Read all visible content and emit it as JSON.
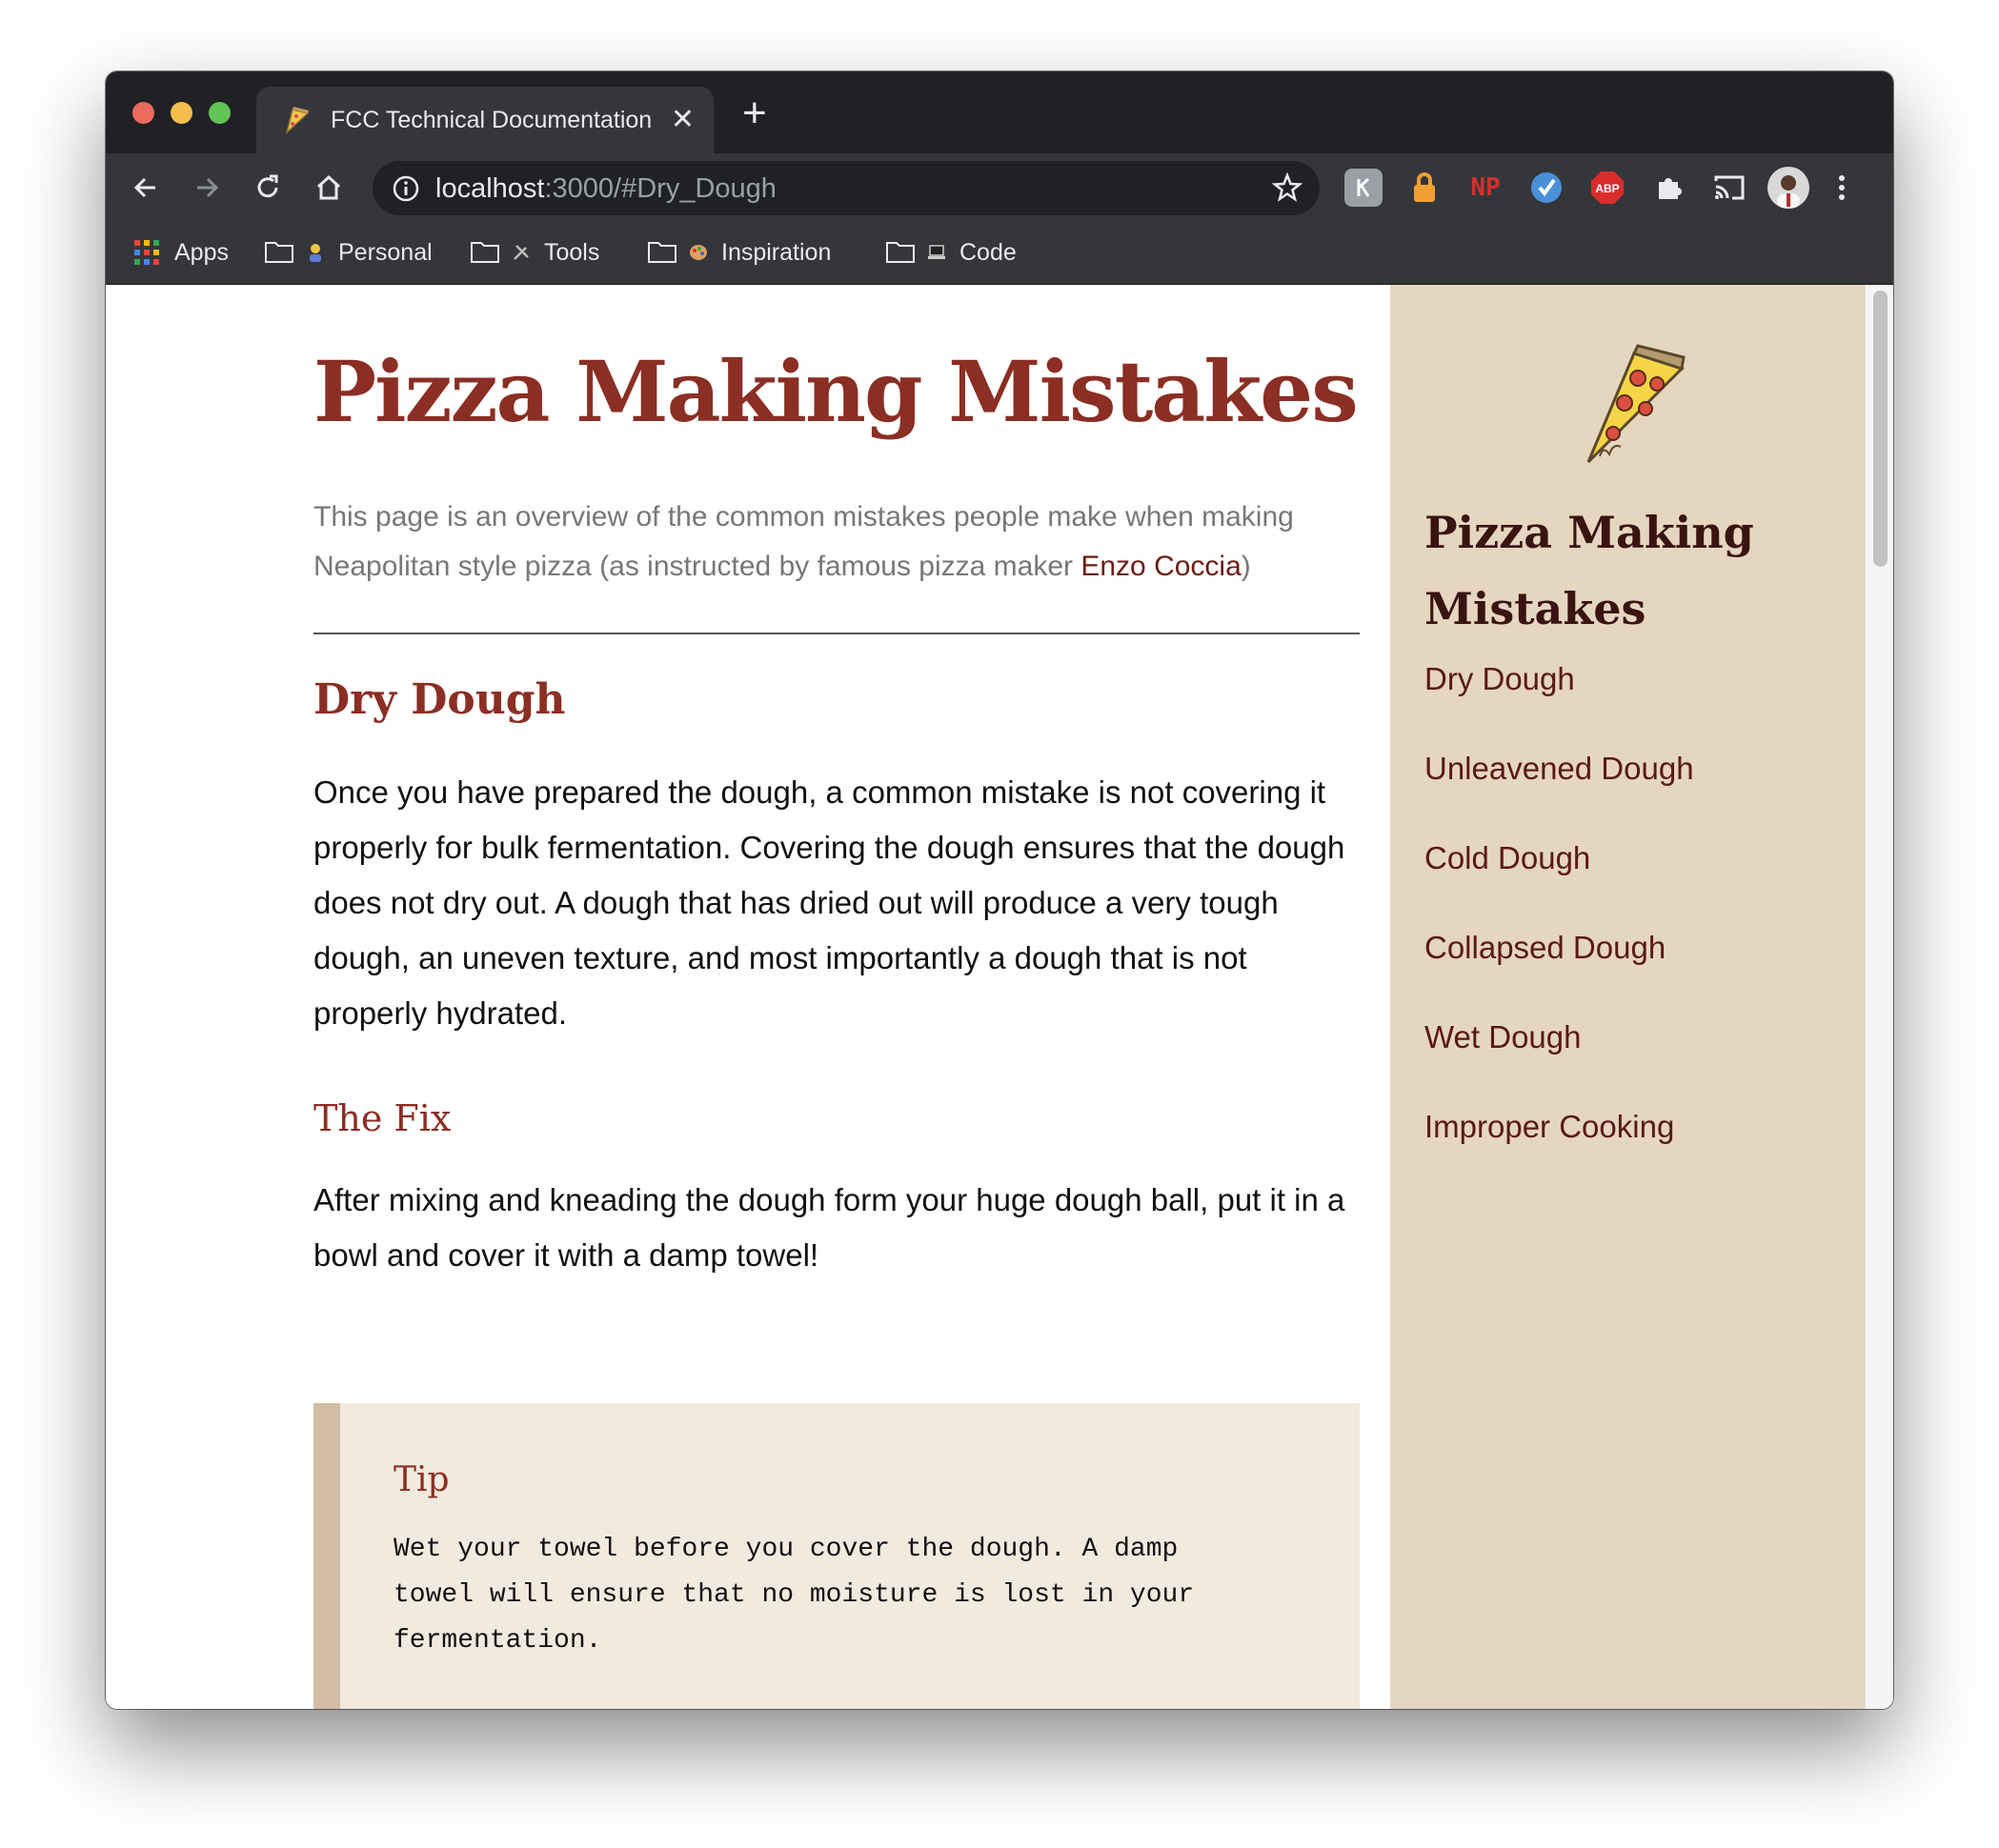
{
  "browser": {
    "tab_title": "FCC Technical Documentation",
    "tab_close": "✕",
    "new_tab": "+",
    "url_host": "localhost",
    "url_rest": ":3000/#Dry_Dough",
    "extensions": [
      "keep-icon",
      "lock-icon",
      "np-icon",
      "tracker-icon",
      "adblock-icon",
      "puzzle-icon",
      "cast-icon",
      "avatar"
    ],
    "ext_np_label": "NP",
    "ext_abp_label": "ABP"
  },
  "bookmarks": {
    "apps": "Apps",
    "personal": "Personal",
    "tools": "Tools",
    "inspiration": "Inspiration",
    "code": "Code"
  },
  "main": {
    "title": "Pizza Making Mistakes",
    "intro_text": "This page is an overview of the common mistakes people make when making Neapolitan style pizza (as instructed by famous pizza maker ",
    "intro_link": "Enzo Coccia",
    "intro_end": ")",
    "section_title": "Dry Dough",
    "section_para": "Once you have prepared the dough, a common mistake is not covering it properly for bulk fermentation. Covering the dough ensures that the dough does not dry out. A dough that has dried out will produce a very tough dough, an uneven texture, and most importantly a dough that is not properly hydrated.",
    "fix_title": "The Fix",
    "fix_para": "After mixing and kneading the dough form your huge dough ball, put it in a bowl and cover it with a damp towel!",
    "tip_title": "Tip",
    "tip_text": "Wet your towel before you cover the dough. A damp towel will ensure that no moisture is lost in your fermentation."
  },
  "sidebar": {
    "title": "Pizza Making Mistakes",
    "links": [
      "Dry Dough",
      "Unleavened Dough",
      "Cold Dough",
      "Collapsed Dough",
      "Wet Dough",
      "Improper Cooking"
    ]
  },
  "colors": {
    "accent": "#8b2e24",
    "sidebar_bg": "#e5d6c0",
    "tip_bg": "#f1eadf",
    "tip_border": "#d2bca3",
    "chrome_dark": "#202124",
    "chrome_toolbar": "#35363a"
  }
}
